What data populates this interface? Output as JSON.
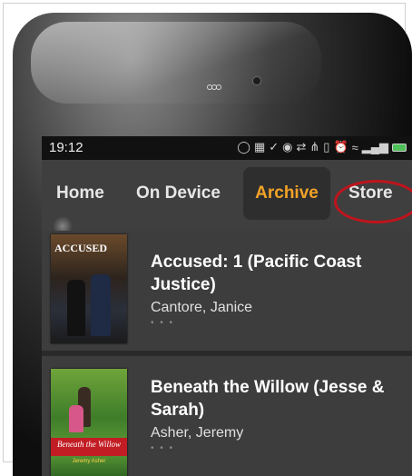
{
  "status_bar": {
    "time": "19:12"
  },
  "nav": {
    "tabs": [
      {
        "label": "Home"
      },
      {
        "label": "On Device"
      },
      {
        "label": "Archive",
        "active": true
      },
      {
        "label": "Store",
        "highlighted": true
      }
    ]
  },
  "books": [
    {
      "title": "Accused: 1 (Pacific Coast Justice)",
      "author": "Cantore, Janice",
      "more": "• • •",
      "cover_text": "ACCUSED"
    },
    {
      "title": "Beneath the Willow (Jesse & Sarah)",
      "author": "Asher, Jeremy",
      "more": "• • •",
      "cover_text": "Beneath the Willow",
      "cover_author": "Jeremy Asher"
    }
  ],
  "colors": {
    "active_tab": "#f2a227",
    "highlight_circle": "#c0141c",
    "battery": "#4ec05a"
  }
}
